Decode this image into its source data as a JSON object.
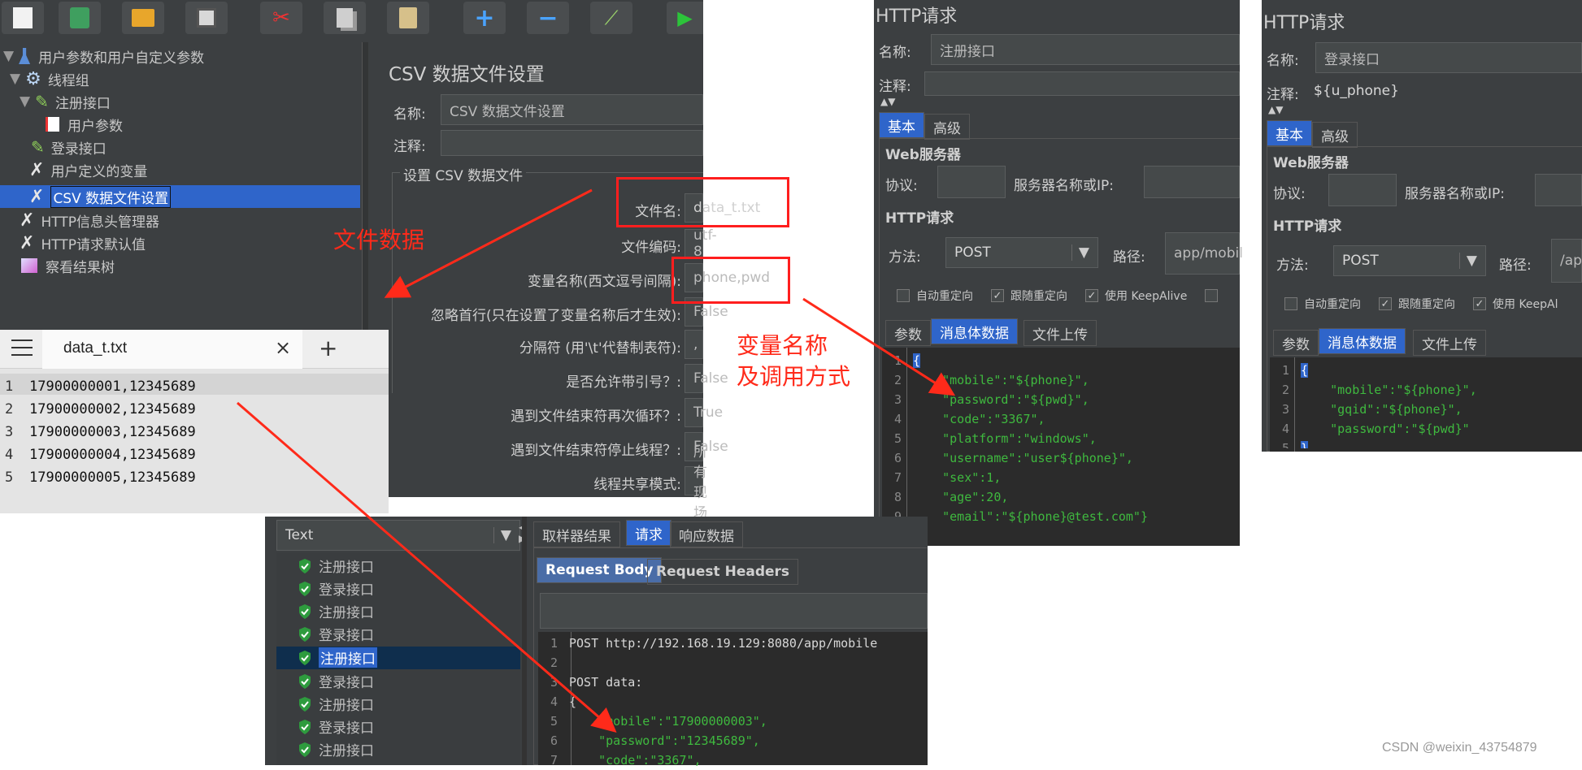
{
  "jmeter_tree": {
    "items": [
      {
        "label": "用户参数和用户自定义参数",
        "icon": "flask-icon"
      },
      {
        "label": "线程组",
        "icon": "gear-icon"
      },
      {
        "label": "注册接口",
        "icon": "pipette-icon"
      },
      {
        "label": "用户参数",
        "icon": "doc-icon"
      },
      {
        "label": "登录接口",
        "icon": "pipette-icon"
      },
      {
        "label": "用户定义的变量",
        "icon": "wrench-icon"
      },
      {
        "label": "CSV 数据文件设置",
        "icon": "wrench-icon"
      },
      {
        "label": "HTTP信息头管理器",
        "icon": "wrench-icon"
      },
      {
        "label": "HTTP请求默认值",
        "icon": "wrench-icon"
      },
      {
        "label": "察看结果树",
        "icon": "chart-icon"
      }
    ]
  },
  "csv_panel": {
    "title": "CSV 数据文件设置",
    "name_label": "名称:",
    "name_value": "CSV 数据文件设置",
    "comment_label": "注释:",
    "section_title": "设置 CSV 数据文件",
    "rows": [
      {
        "label": "文件名:",
        "value": "data_t.txt"
      },
      {
        "label": "文件编码:",
        "value": "utf-8"
      },
      {
        "label": "变量名称(西文逗号间隔):",
        "value": "phone,pwd"
      },
      {
        "label": "忽略首行(只在设置了变量名称后才生效):",
        "value": "False"
      },
      {
        "label": "分隔符 (用'\\t'代替制表符):",
        "value": ","
      },
      {
        "label": "是否允许带引号？:",
        "value": "False"
      },
      {
        "label": "遇到文件结束符再次循环？:",
        "value": "True"
      },
      {
        "label": "遇到文件结束符停止线程？:",
        "value": "False"
      },
      {
        "label": "线程共享模式:",
        "value": "所有现场"
      }
    ]
  },
  "annotations": {
    "file_data": "文件数据",
    "var_name": "变量名称",
    "call_method": "及调用方式"
  },
  "notepad": {
    "tab_title": "data_t.txt",
    "lines": [
      {
        "n": "1",
        "text": "17900000001,12345689"
      },
      {
        "n": "2",
        "text": "17900000002,12345689"
      },
      {
        "n": "3",
        "text": "17900000003,12345689"
      },
      {
        "n": "4",
        "text": "17900000004,12345689"
      },
      {
        "n": "5",
        "text": "17900000005,12345689"
      }
    ]
  },
  "http_register": {
    "title": "HTTP请求",
    "name_label": "名称:",
    "name_value": "注册接口",
    "comment_label": "注释:",
    "comment_value": "",
    "tabs": [
      "基本",
      "高级"
    ],
    "web_server": "Web服务器",
    "protocol_label": "协议:",
    "server_label": "服务器名称或IP:",
    "http_section": "HTTP请求",
    "method_label": "方法:",
    "method_value": "POST",
    "path_label": "路径:",
    "path_value": "app/mobil",
    "checks": [
      {
        "label": "自动重定向",
        "checked": false
      },
      {
        "label": "跟随重定向",
        "checked": true
      },
      {
        "label": "使用 KeepAlive",
        "checked": true
      }
    ],
    "body_tabs": [
      "参数",
      "消息体数据",
      "文件上传"
    ],
    "code": [
      {
        "n": "1",
        "text": "{"
      },
      {
        "n": "2",
        "text": "    \"mobile\":\"${phone}\","
      },
      {
        "n": "3",
        "text": "    \"password\":\"${pwd}\","
      },
      {
        "n": "4",
        "text": "    \"code\":\"3367\","
      },
      {
        "n": "5",
        "text": "    \"platform\":\"windows\","
      },
      {
        "n": "6",
        "text": "    \"username\":\"user${phone}\","
      },
      {
        "n": "7",
        "text": "    \"sex\":1,"
      },
      {
        "n": "8",
        "text": "    \"age\":20,"
      },
      {
        "n": "9",
        "text": "    \"email\":\"${phone}@test.com\"}"
      }
    ]
  },
  "http_login": {
    "title": "HTTP请求",
    "name_label": "名称:",
    "name_value": "登录接口",
    "comment_label": "注释:",
    "comment_value": "${u_phone}",
    "tabs": [
      "基本",
      "高级"
    ],
    "web_server": "Web服务器",
    "protocol_label": "协议:",
    "server_label": "服务器名称或IP:",
    "http_section": "HTTP请求",
    "method_label": "方法:",
    "method_value": "POST",
    "path_label": "路径:",
    "path_value": "/ap",
    "checks": [
      {
        "label": "自动重定向",
        "checked": false
      },
      {
        "label": "跟随重定向",
        "checked": true
      },
      {
        "label": "使用 KeepAl",
        "checked": true
      }
    ],
    "body_tabs": [
      "参数",
      "消息体数据",
      "文件上传"
    ],
    "code": [
      {
        "n": "1",
        "text": "{"
      },
      {
        "n": "2",
        "text": "    \"mobile\":\"${phone}\","
      },
      {
        "n": "3",
        "text": "    \"gqid\":\"${phone}\","
      },
      {
        "n": "4",
        "text": "    \"password\":\"${pwd}\""
      },
      {
        "n": "5",
        "text": "}"
      }
    ]
  },
  "results": {
    "renderer": "Text",
    "items": [
      "注册接口",
      "登录接口",
      "注册接口",
      "登录接口",
      "注册接口",
      "登录接口",
      "注册接口",
      "登录接口",
      "注册接口"
    ],
    "selected_index": 4,
    "tabs": [
      "取样器结果",
      "请求",
      "响应数据"
    ],
    "sub_tabs": [
      "Request Body",
      "Request Headers"
    ],
    "code": [
      {
        "n": "1",
        "text": "POST http://192.168.19.129:8080/app/mobile"
      },
      {
        "n": "2",
        "text": ""
      },
      {
        "n": "3",
        "text": "POST data:"
      },
      {
        "n": "4",
        "text": "{"
      },
      {
        "n": "5",
        "text": "    \"mobile\":\"17900000003\","
      },
      {
        "n": "6",
        "text": "    \"password\":\"12345689\","
      },
      {
        "n": "7",
        "text": "    \"code\":\"3367\","
      }
    ]
  },
  "watermark": "CSDN @weixin_43754879",
  "colors": {
    "panel_bg": "#3c3f41",
    "selection": "#2f65ca",
    "annotation_red": "#ff2a1a",
    "code_green": "#3fb93f"
  }
}
